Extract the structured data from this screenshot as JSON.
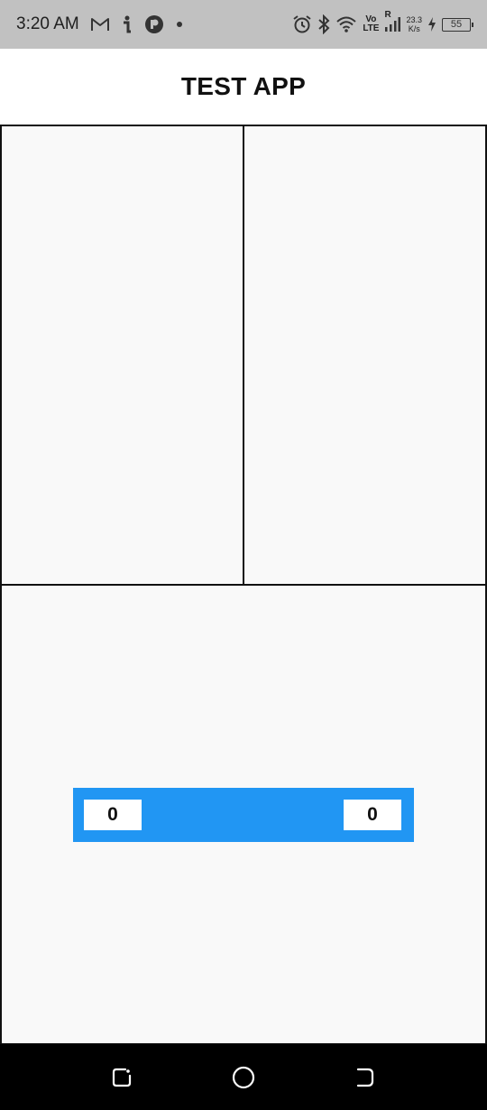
{
  "status_bar": {
    "time": "3:20 AM",
    "volte_top": "Vo",
    "volte_bottom": "LTE",
    "roaming": "R",
    "speed_value": "23.3",
    "speed_unit": "K/s",
    "battery": "55"
  },
  "app_bar": {
    "title": "TEST APP"
  },
  "score_bar": {
    "left_score": "0",
    "right_score": "0",
    "color": "#2196f3"
  },
  "nav_bar": {
    "buttons": [
      "recents-icon",
      "home-icon",
      "back-icon"
    ]
  }
}
